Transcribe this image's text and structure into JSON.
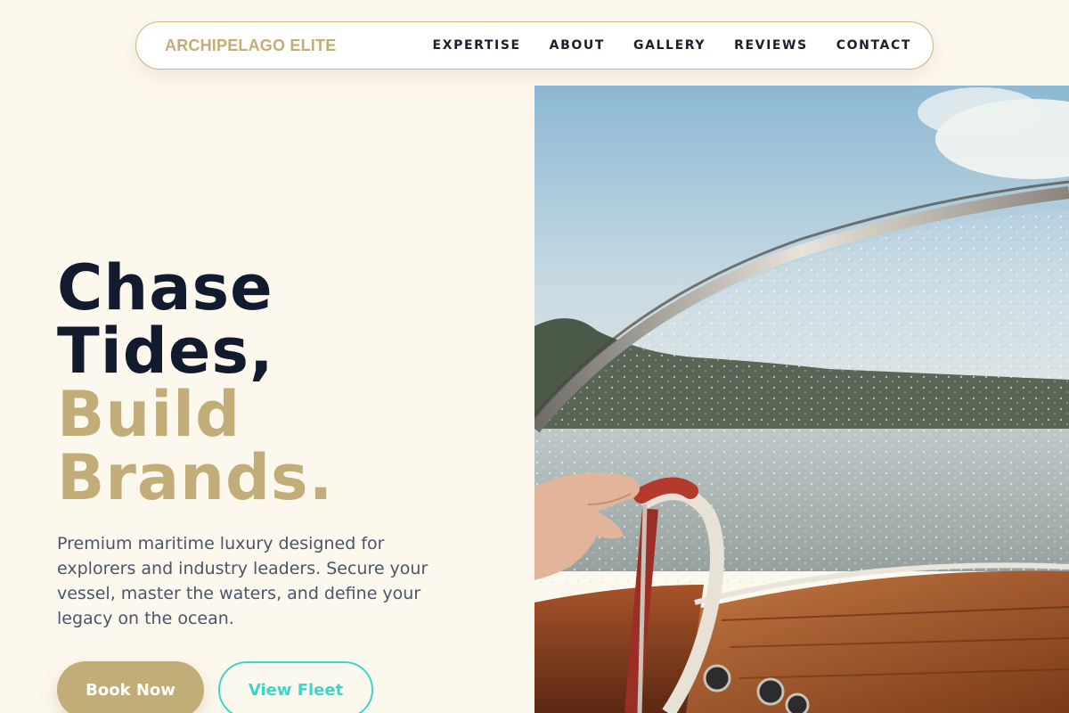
{
  "header": {
    "brand": "ARCHIPELAGO ELITE",
    "nav": [
      "EXPERTISE",
      "ABOUT",
      "GALLERY",
      "REVIEWS",
      "CONTACT"
    ]
  },
  "hero": {
    "headline_dark": [
      "Chase",
      "Tides,"
    ],
    "headline_gold": [
      "Build",
      "Brands."
    ],
    "description": "Premium maritime luxury designed for explorers and industry leaders. Secure your vessel, master the waters, and define your legacy on the ocean.",
    "primary_button": "Book Now",
    "secondary_button": "View Fleet"
  },
  "colors": {
    "background": "#fdf8ee",
    "gold": "#c2ac78",
    "navy": "#121a2e",
    "teal": "#3ed4c8",
    "body_text": "#4a5568"
  },
  "image": {
    "subject": "boat-windshield-helm-photo"
  }
}
